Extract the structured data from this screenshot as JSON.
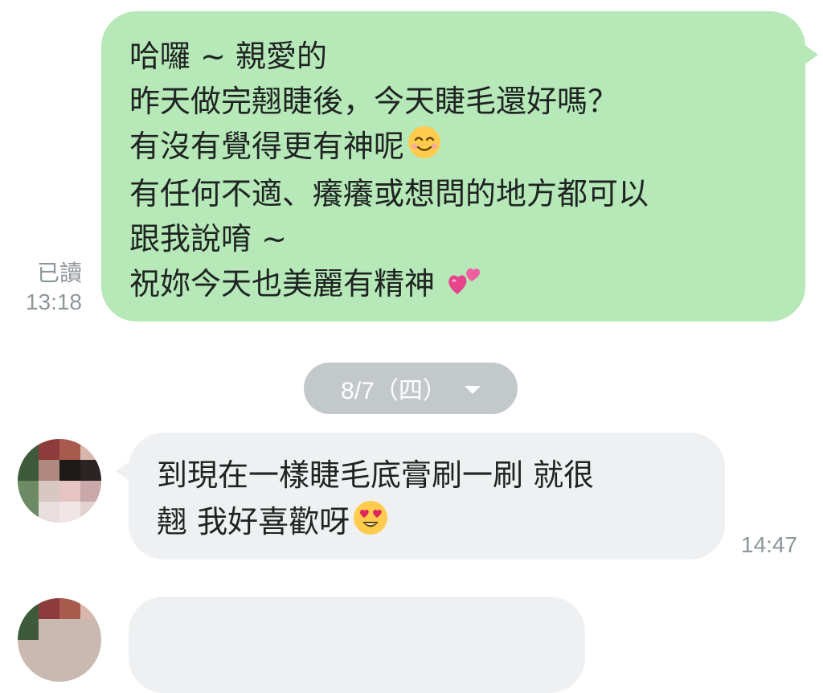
{
  "outgoing_message": {
    "lines": [
      "哈囉 ~ 親愛的",
      "昨天做完翹睫後，今天睫毛還好嗎？",
      "有沒有覺得更有神呢",
      "有任何不適、癢癢或想問的地方都可以",
      "跟我說唷 ~",
      "祝妳今天也美麗有精神"
    ],
    "emoji_line3": "smiling-face-icon",
    "emoji_line6": "two-hearts-icon",
    "read_label": "已讀",
    "time": "13:18",
    "bubble_color": "#b6e8b8"
  },
  "date_divider": {
    "label": "8/7（四）",
    "icon": "chevron-down-icon"
  },
  "incoming_message": {
    "lines": [
      "到現在一樣睫毛底膏刷一刷 就很",
      "翹 我好喜歡呀"
    ],
    "emoji": "heart-eyes-face-icon",
    "time": "14:47",
    "bubble_color": "#eef0f2"
  }
}
